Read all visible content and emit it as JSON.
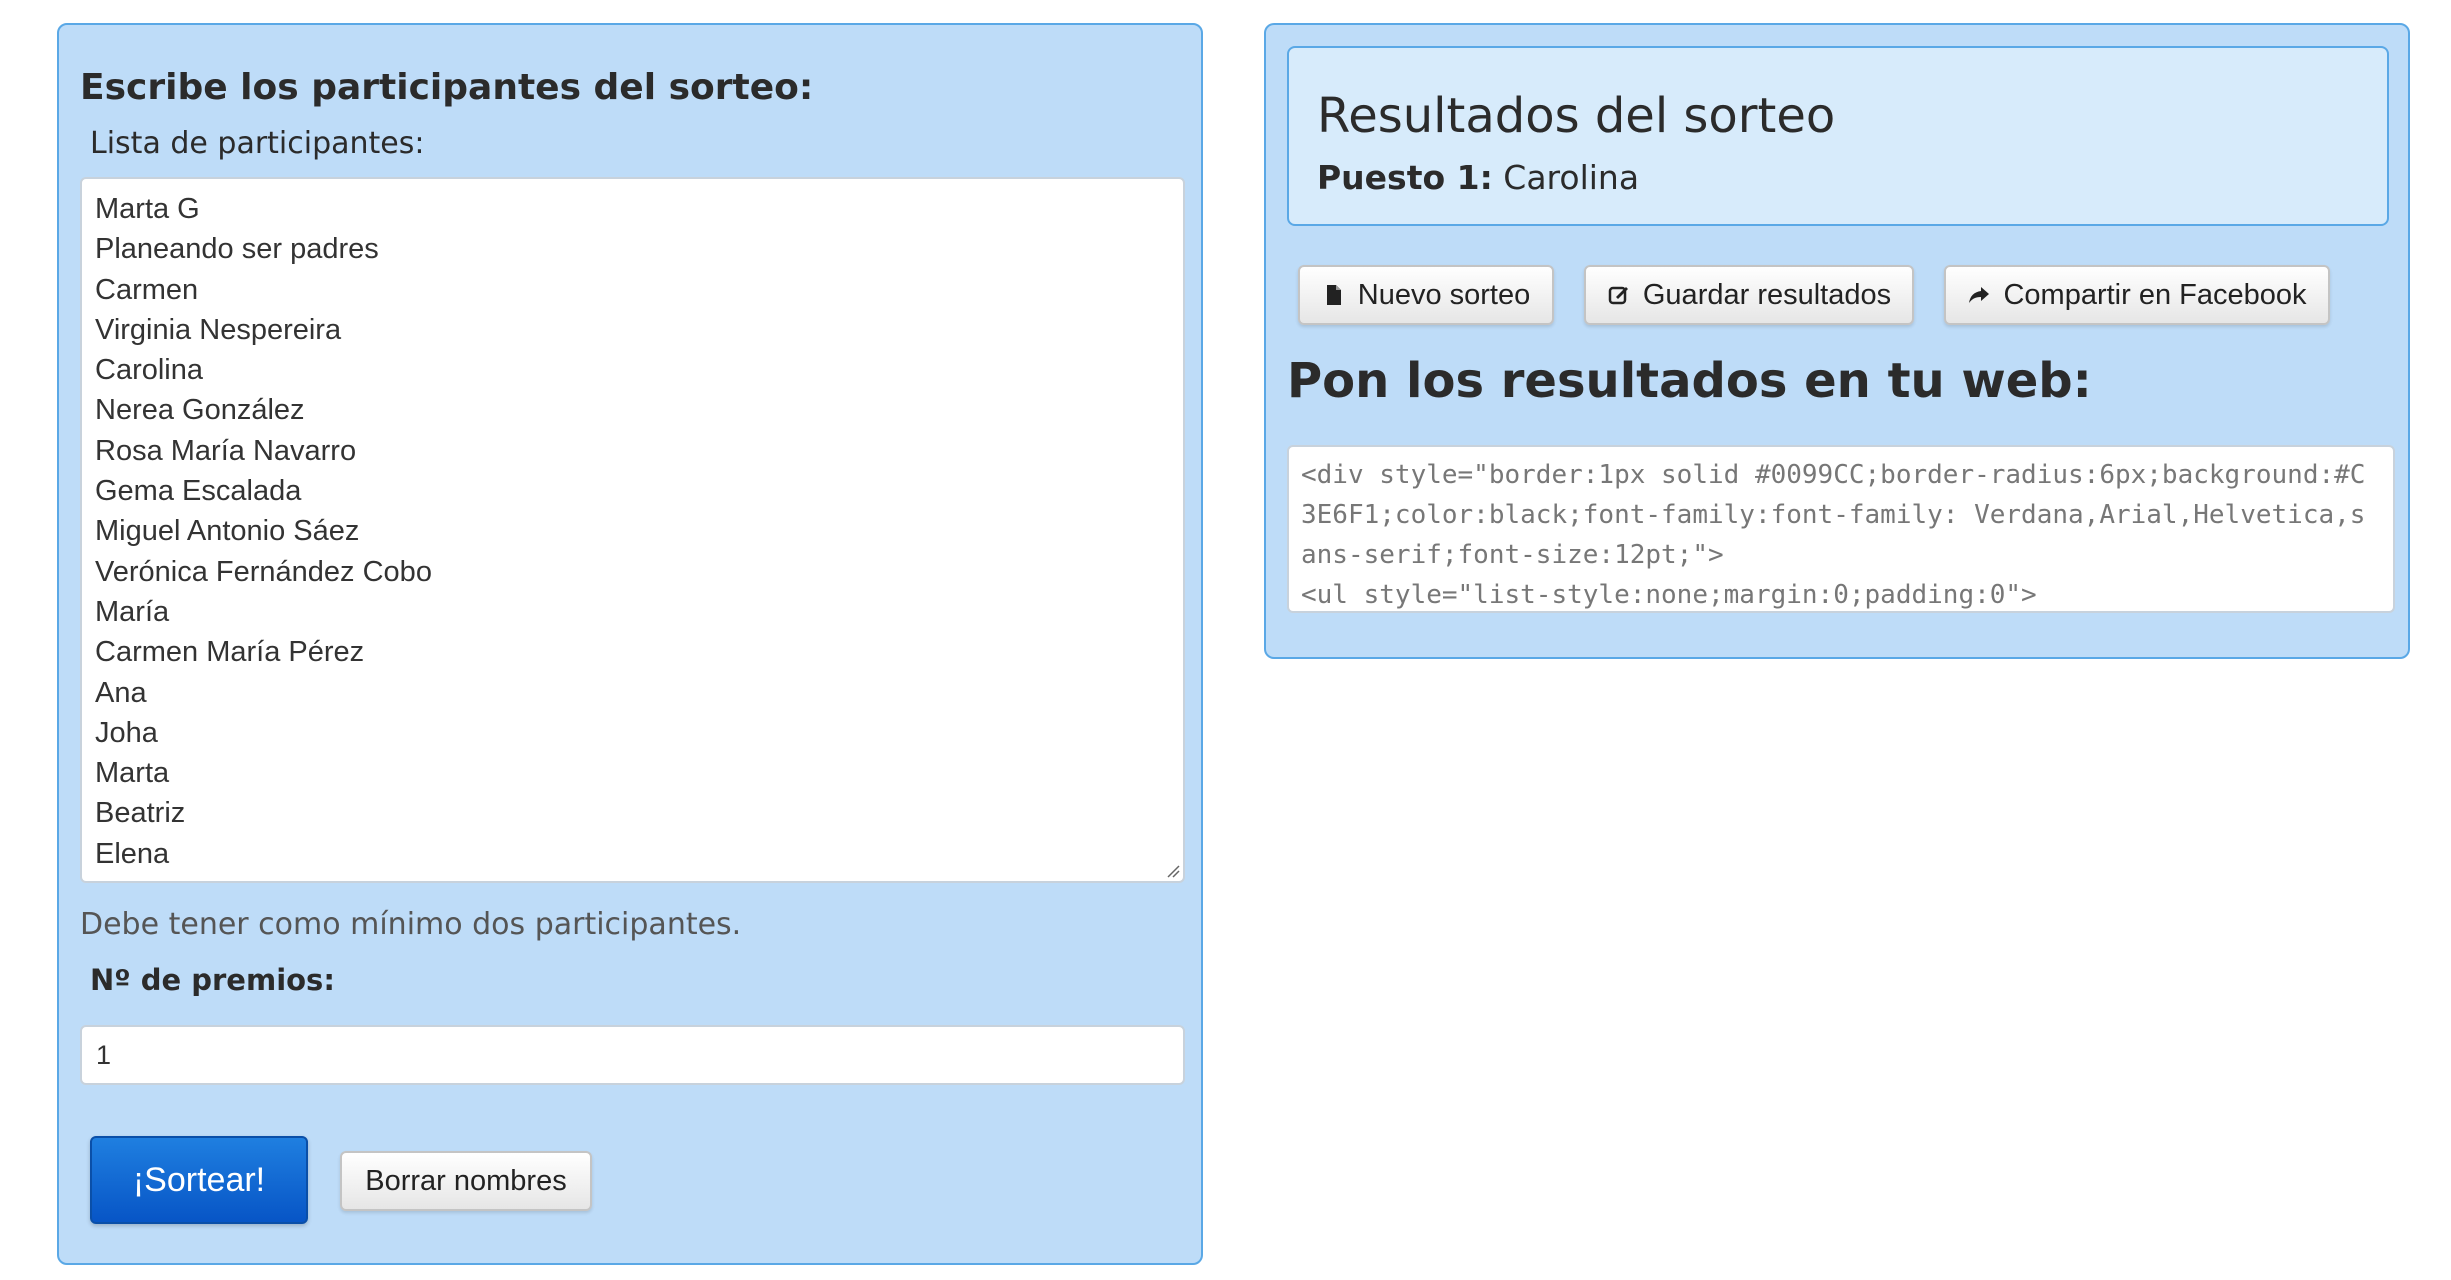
{
  "left": {
    "heading": "Escribe los participantes del sorteo:",
    "list_label": "Lista de participantes:",
    "participants": [
      "Marta G",
      "Planeando ser padres",
      "Carmen",
      "Virginia Nespereira",
      "Carolina",
      "Nerea González",
      "Rosa María Navarro",
      "Gema Escalada",
      "Miguel Antonio Sáez",
      "Verónica Fernández Cobo",
      "María",
      "Carmen María Pérez",
      "Ana",
      "Joha",
      "Marta",
      "Beatriz",
      "Elena"
    ],
    "min_note": "Debe tener como mínimo dos participantes.",
    "prizes_label": "Nº de premios:",
    "prizes_value": "1",
    "sortear_label": "¡Sortear!",
    "borrar_label": "Borrar nombres"
  },
  "right": {
    "results_title": "Resultados del sorteo",
    "position_label": "Puesto 1:",
    "position_value": "Carolina",
    "nuevo_label": "Nuevo sorteo",
    "guardar_label": "Guardar resultados",
    "compartir_label": "Compartir en Facebook",
    "web_heading": "Pon los resultados en tu web:",
    "embed_code": "<div style=\"border:1px solid #0099CC;border-radius:6px;background:#C3E6F1;color:black;font-family:font-family: Verdana,Arial,Helvetica,sans-serif;font-size:12pt;\">\n<ul style=\"list-style:none;margin:0;padding:0\">"
  },
  "colors": {
    "panel_bg": "#bedcf8",
    "panel_border": "#5aa8e6",
    "primary_button": "#0a63d4"
  },
  "icons": {
    "nuevo": "file-icon",
    "guardar": "edit-icon",
    "compartir": "share-icon"
  }
}
